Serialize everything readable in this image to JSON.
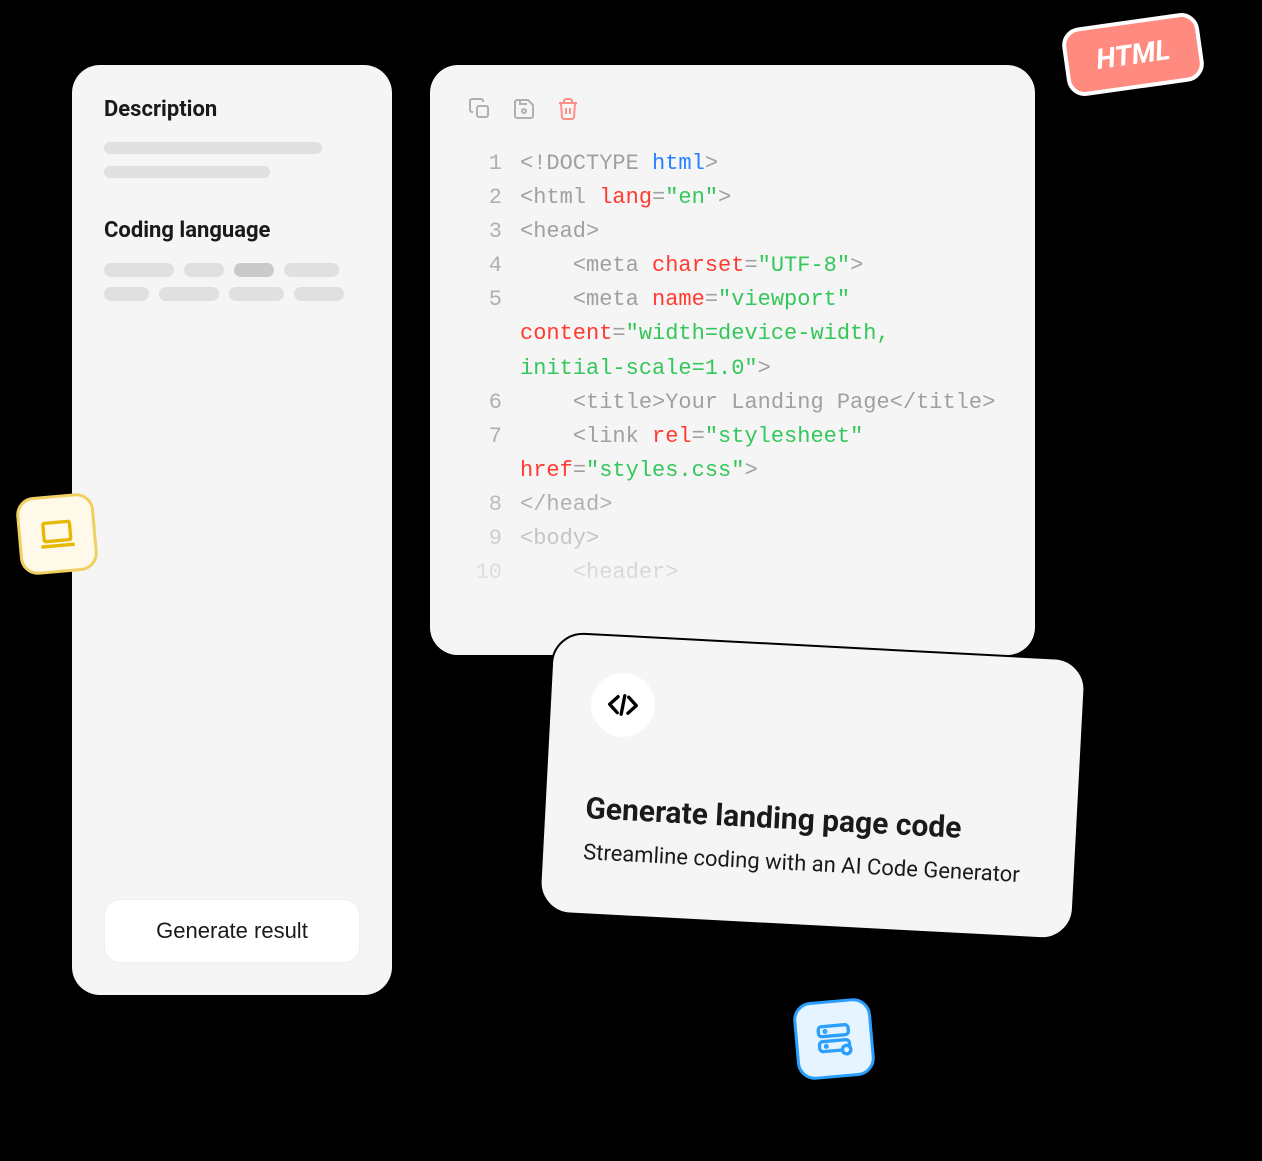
{
  "leftPanel": {
    "section1Title": "Description",
    "section2Title": "Coding language",
    "generateButton": "Generate result"
  },
  "htmlBadge": "HTML",
  "code": {
    "lines": [
      {
        "num": "1",
        "raw": "<!DOCTYPE html>"
      },
      {
        "num": "2",
        "raw": "<html lang=\"en\">"
      },
      {
        "num": "3",
        "raw": "<head>"
      },
      {
        "num": "4",
        "raw": "    <meta charset=\"UTF-8\">"
      },
      {
        "num": "5",
        "raw": "    <meta name=\"viewport\" content=\"width=device-width, initial-scale=1.0\">"
      },
      {
        "num": "6",
        "raw": "    <title>Your Landing Page</title>"
      },
      {
        "num": "7",
        "raw": "    <link rel=\"stylesheet\" href=\"styles.css\">"
      },
      {
        "num": "8",
        "raw": "</head>"
      },
      {
        "num": "9",
        "raw": "<body>"
      },
      {
        "num": "10",
        "raw": "    <header>"
      }
    ]
  },
  "card": {
    "title": "Generate landing page code",
    "subtitle": "Streamline coding with an AI Code Generator"
  }
}
